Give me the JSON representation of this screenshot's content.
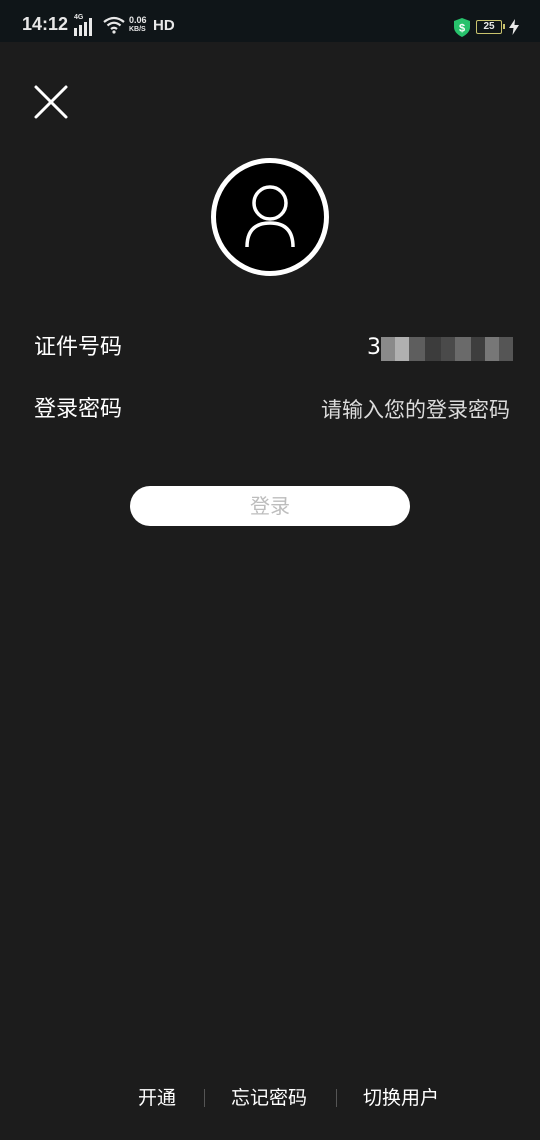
{
  "status_bar": {
    "time": "14:12",
    "network_type": "4G",
    "speed_value": "0.06",
    "speed_unit": "KB/S",
    "hd": "HD",
    "battery": "25",
    "icons": [
      "signal-icon",
      "wifi-icon",
      "shield-icon",
      "battery-icon",
      "charging-icon"
    ]
  },
  "header": {
    "close_icon": "close-icon"
  },
  "avatar": {
    "icon": "user-icon"
  },
  "form": {
    "id_label": "证件号码",
    "id_value_visible": "3",
    "password_label": "登录密码",
    "password_placeholder": "请输入您的登录密码",
    "password_value": ""
  },
  "actions": {
    "login_label": "登录"
  },
  "footer": {
    "open_label": "开通",
    "forgot_label": "忘记密码",
    "switch_label": "切换用户"
  },
  "colors": {
    "background": "#1c1c1c",
    "status_bar": "#0f1518",
    "text": "#ffffff",
    "button_bg": "#ffffff",
    "button_text": "#bdbdbd",
    "divider": "#555555"
  }
}
